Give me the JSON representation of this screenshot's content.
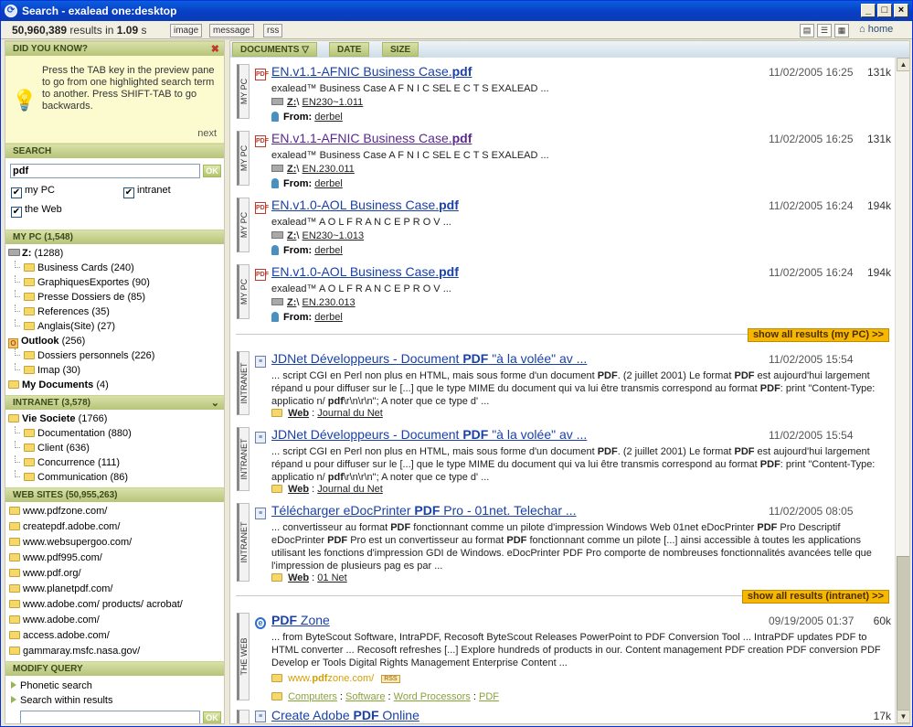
{
  "window": {
    "title": "Search - exalead one:desktop"
  },
  "toolbar": {
    "result_count": "50,960,389",
    "results_in": "results in",
    "time": "1.09",
    "time_unit": "s",
    "buttons": [
      "image",
      "message",
      "rss"
    ],
    "home": "home"
  },
  "did_you_know": {
    "header": "DID YOU KNOW?",
    "tip": "Press the TAB key in the preview pane to go from one highlighted search term to another. Press SHIFT-TAB to go backwards.",
    "next": "next"
  },
  "search": {
    "header": "SEARCH",
    "query": "pdf",
    "ok": "OK",
    "options": [
      {
        "label": "my PC",
        "checked": true
      },
      {
        "label": "intranet",
        "checked": true
      },
      {
        "label": "the Web",
        "checked": true
      }
    ]
  },
  "my_pc": {
    "header": "MY PC (1,548)",
    "drive": "Z:",
    "drive_count": "(1288)",
    "folders": [
      {
        "name": "Business Cards",
        "count": "(240)"
      },
      {
        "name": "GraphiquesExportes",
        "count": "(90)"
      },
      {
        "name": "Presse Dossiers de",
        "count": "(85)"
      },
      {
        "name": "References",
        "count": "(35)"
      },
      {
        "name": "Anglais(Site)",
        "count": "(27)"
      }
    ],
    "outlook": {
      "name": "Outlook",
      "count": "(256)"
    },
    "outlook_folders": [
      {
        "name": "Dossiers personnels",
        "count": "(226)"
      },
      {
        "name": "Imap",
        "count": "(30)"
      }
    ],
    "mydocs": {
      "name": "My Documents",
      "count": "(4)"
    }
  },
  "intranet": {
    "header": "INTRANET (3,578)",
    "root": {
      "name": "Vie Societe",
      "count": "(1766)"
    },
    "folders": [
      {
        "name": "Documentation",
        "count": "(880)"
      },
      {
        "name": "Client",
        "count": "(636)"
      },
      {
        "name": "Concurrence",
        "count": "(111)"
      },
      {
        "name": "Communication",
        "count": "(86)"
      }
    ]
  },
  "web_sites": {
    "header": "WEB SITES (50,955,263)",
    "sites": [
      "www.pdfzone.com/",
      "createpdf.adobe.com/",
      "www.websupergoo.com/",
      "www.pdf995.com/",
      "www.pdf.org/",
      "www.planetpdf.com/",
      "www.adobe.com/ products/ acrobat/",
      "www.adobe.com/",
      "access.adobe.com/",
      "gammaray.msfc.nasa.gov/"
    ]
  },
  "modify_query": {
    "header": "MODIFY QUERY",
    "items": [
      "Phonetic search",
      "Search within results"
    ],
    "ok": "OK"
  },
  "sort": {
    "documents": "DOCUMENTS",
    "date": "DATE",
    "size": "SIZE"
  },
  "mypc_results": [
    {
      "source": "MY PC",
      "title_pre": "EN.v1.1-AFNIC Business Case.",
      "title_kw": "pdf",
      "date": "11/02/2005 16:25",
      "size": "131k",
      "snippet": "exalead™ Business Case A F N I C SEL E C T S EXALEAD ...",
      "path_drive": "Z:",
      "path_sep": "\\",
      "path": "EN230~1.011",
      "from_label": "From:",
      "from": "derbel"
    },
    {
      "source": "MY PC",
      "title_pre": "EN.v1.1-AFNIC Business Case.",
      "title_kw": "pdf",
      "date": "11/02/2005 16:25",
      "size": "131k",
      "snippet": "exalead™ Business Case A F N I C SEL E C T S EXALEAD ...",
      "path_drive": "Z:",
      "path_sep": "\\",
      "path": "EN.230.011",
      "from_label": "From:",
      "from": "derbel"
    },
    {
      "source": "MY PC",
      "title_pre": "EN.v1.0-AOL Business Case.",
      "title_kw": "pdf",
      "date": "11/02/2005 16:24",
      "size": "194k",
      "snippet": "exalead™ A O L F R A N C E P R O V ...",
      "path_drive": "Z:",
      "path_sep": "\\",
      "path": "EN230~1.013",
      "from_label": "From:",
      "from": "derbel"
    },
    {
      "source": "MY PC",
      "title_pre": "EN.v1.0-AOL Business Case.",
      "title_kw": "pdf",
      "date": "11/02/2005 16:24",
      "size": "194k",
      "snippet": "exalead™ A O L F R A N C E P R O V ...",
      "path_drive": "Z:",
      "path_sep": "\\",
      "path": "EN.230.013",
      "from_label": "From:",
      "from": "derbel"
    }
  ],
  "show_all_mypc": "show all results (my PC) >>",
  "intranet_results": [
    {
      "source": "INTRANET",
      "t1": "JDNet Développeurs - Document ",
      "t2": "PDF",
      "t3": " \"à la volée\" av ...",
      "date": "11/02/2005 15:54",
      "s1": "... script CGI en Perl non plus en HTML, mais sous forme d'un document ",
      "s2": "PDF",
      "s3": ". (2 juillet 2001) Le format ",
      "s4": "PDF",
      "s5": " est aujourd'hui largement répand u pour diffuser sur le [...] que le type MIME du document qui va lui être transmis correspond au format ",
      "s6": "PDF",
      "s7": ": print \"Content-Type: applicatio n/ ",
      "s8": "pdf",
      "s9": "\\r\\n\\r\\n\"; A noter que ce type d' ...",
      "cat": "Web",
      "sep": ":",
      "site": "Journal du Net"
    },
    {
      "source": "INTRANET",
      "t1": "JDNet Développeurs - Document ",
      "t2": "PDF",
      "t3": " \"à la volée\" av ...",
      "date": "11/02/2005 15:54",
      "s1": "... script CGI en Perl non plus en HTML, mais sous forme d'un document ",
      "s2": "PDF",
      "s3": ". (2 juillet 2001) Le format ",
      "s4": "PDF",
      "s5": " est aujourd'hui largement répand u pour diffuser sur le [...] que le type MIME du document qui va lui être transmis correspond au format ",
      "s6": "PDF",
      "s7": ": print \"Content-Type: applicatio n/ ",
      "s8": "pdf",
      "s9": "\\r\\n\\r\\n\"; A noter que ce type d' ...",
      "cat": "Web",
      "sep": ":",
      "site": "Journal du Net"
    },
    {
      "source": "INTRANET",
      "t1": "Télécharger eDocPrinter ",
      "t2": "PDF",
      "t3": " Pro - 01net. Telechar ...",
      "date": "11/02/2005 08:05",
      "s1": "... convertisseur au format ",
      "s2": "PDF",
      "s3": " fonctionnant comme un pilote d'impression Windows Web 01net eDocPrinter ",
      "s4": "PDF",
      "s5": " Pro Descriptif eDocPrinter ",
      "s6": "PDF",
      "s7": " Pro est un convertisseur au format ",
      "s8": "PDF",
      "s9": " fonctionnant comme un pilote [...] ainsi accessible à toutes les applications utilisant les fonctions d'impression GDI de Windows. eDocPrinter PDF Pro comporte de nombreuses fonctionnalités avancées telle que l'impression de plusieurs pag es par ...",
      "cat": "Web",
      "sep": ":",
      "site": "01 Net"
    }
  ],
  "show_all_intranet": "show all results (intranet) >>",
  "web_results": [
    {
      "source": "THE WEB",
      "t1": "PDF",
      "t2": " Zone",
      "date": "09/19/2005 01:37",
      "size": "60k",
      "snippet": "... from ByteScout Software, IntraPDF, Recosoft ByteScout Releases PowerPoint to PDF Conversion Tool ... IntraPDF updates PDF to HTML converter ... Recosoft refreshes [...] Explore hundreds of products in our. Content management PDF creation PDF conversion PDF Develop er Tools Digital Rights Management Enterprise Content ...",
      "url_pre": "www.",
      "url_kw": "pdf",
      "url_post": "zone.com/",
      "rss": "RSS",
      "crumbs": [
        "Computers",
        "Software",
        "Word Processors",
        "PDF"
      ],
      "crumb_sep": ":"
    },
    {
      "source": "THE WEB",
      "t1": "Create Adobe ",
      "t2": "PDF",
      "t3": " Online",
      "size": "17k"
    }
  ],
  "colors": {
    "accent_green": "#b6c479",
    "link": "#1a41a8",
    "show_all": "#f5b700"
  }
}
